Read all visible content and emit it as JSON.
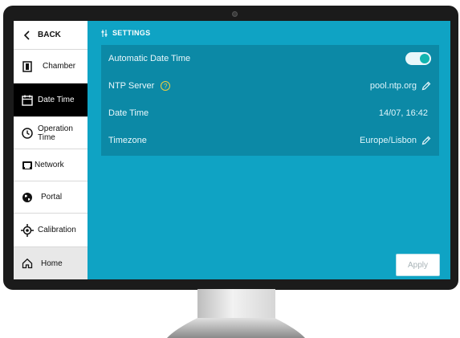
{
  "sidebar": {
    "back_label": "BACK",
    "items": [
      {
        "label": "Chamber",
        "icon": "chamber-icon"
      },
      {
        "label": "Date Time",
        "icon": "calendar-icon",
        "active": true
      },
      {
        "label": "Operation\nTime",
        "icon": "clock-icon"
      },
      {
        "label": "Network",
        "icon": "network-icon"
      },
      {
        "label": "Portal",
        "icon": "globe-icon"
      },
      {
        "label": "Calibration",
        "icon": "crosshair-icon"
      },
      {
        "label": "Home",
        "icon": "home-icon"
      }
    ]
  },
  "header": {
    "title": "SETTINGS"
  },
  "settings": {
    "auto_datetime_label": "Automatic Date Time",
    "auto_datetime_on": true,
    "ntp_label": "NTP Server",
    "ntp_help": "?",
    "ntp_value": "pool.ntp.org",
    "datetime_label": "Date Time",
    "datetime_value": "14/07, 16:42",
    "timezone_label": "Timezone",
    "timezone_value": "Europe/Lisbon"
  },
  "apply_label": "Apply",
  "colors": {
    "screen": "#0fa3c4",
    "panel": "#0c89a6",
    "toggle_knob": "#12b5b0",
    "help": "#f0d040"
  }
}
